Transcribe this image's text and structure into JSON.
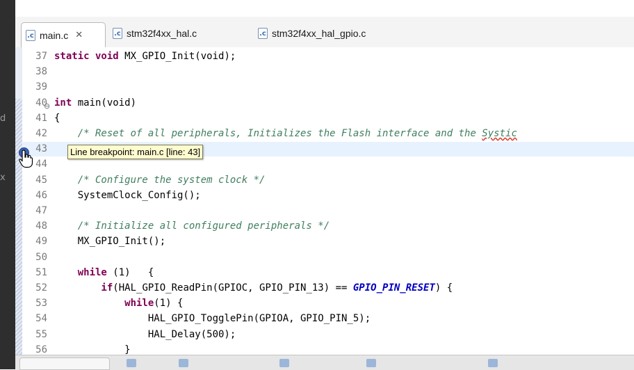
{
  "tabs": [
    {
      "label": "main.c",
      "close": "✕",
      "icon": "c-file-icon"
    },
    {
      "label": "stm32f4xx_hal.c",
      "icon": "c-file-icon"
    },
    {
      "label": "stm32f4xx_hal_gpio.c",
      "icon": "c-file-icon"
    }
  ],
  "file_icon_glyph": ".c",
  "fold_glyph": "⊖",
  "tooltip": "Line breakpoint: main.c [line: 43]",
  "left_marks": [
    "d",
    "x"
  ],
  "lines": [
    {
      "num": "37",
      "parts": [
        [
          "kw",
          "static void "
        ],
        [
          "code",
          "MX_GPIO_Init(void);"
        ]
      ]
    },
    {
      "num": "38",
      "parts": []
    },
    {
      "num": "39",
      "parts": []
    },
    {
      "num": "40",
      "parts": [
        [
          "kw",
          "int "
        ],
        [
          "code",
          "main(void)"
        ]
      ]
    },
    {
      "num": "41",
      "parts": [
        [
          "code",
          "{"
        ]
      ]
    },
    {
      "num": "42",
      "parts": [
        [
          "cm",
          "    /* Reset of all peripherals, Initializes the Flash interface and the "
        ],
        [
          "sq",
          "Systic"
        ]
      ]
    },
    {
      "num": "43",
      "parts": []
    },
    {
      "num": "44",
      "parts": []
    },
    {
      "num": "45",
      "parts": [
        [
          "cm",
          "    /* Configure the system clock */"
        ]
      ]
    },
    {
      "num": "46",
      "parts": [
        [
          "code",
          "    SystemClock_Config();"
        ]
      ]
    },
    {
      "num": "47",
      "parts": []
    },
    {
      "num": "48",
      "parts": [
        [
          "cm",
          "    /* Initialize all configured peripherals */"
        ]
      ]
    },
    {
      "num": "49",
      "parts": [
        [
          "code",
          "    MX_GPIO_Init();"
        ]
      ]
    },
    {
      "num": "50",
      "parts": []
    },
    {
      "num": "51",
      "parts": [
        [
          "kw",
          "    while "
        ],
        [
          "code",
          "(1)   {"
        ]
      ]
    },
    {
      "num": "52",
      "parts": [
        [
          "kw",
          "        if"
        ],
        [
          "code",
          "(HAL_GPIO_ReadPin(GPIOC, GPIO_PIN_13) == "
        ],
        [
          "mc",
          "GPIO_PIN_RESET"
        ],
        [
          "code",
          ") {"
        ]
      ]
    },
    {
      "num": "53",
      "parts": [
        [
          "kw",
          "            while"
        ],
        [
          "code",
          "(1) {"
        ]
      ]
    },
    {
      "num": "54",
      "parts": [
        [
          "code",
          "                HAL_GPIO_TogglePin(GPIOA, GPIO_PIN_5);"
        ]
      ]
    },
    {
      "num": "55",
      "parts": [
        [
          "code",
          "                HAL_Delay(500);"
        ]
      ]
    },
    {
      "num": "56",
      "parts": [
        [
          "code",
          "            }"
        ]
      ]
    }
  ]
}
